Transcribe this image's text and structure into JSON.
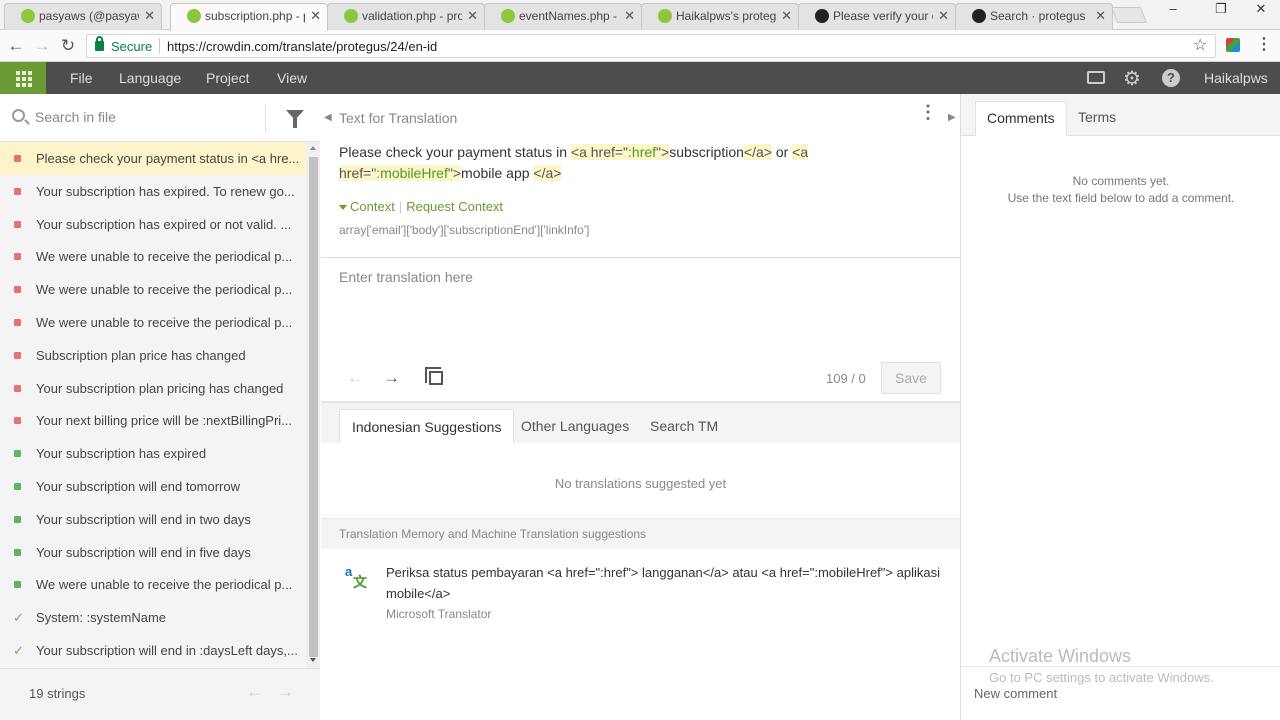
{
  "browser": {
    "tabs": [
      {
        "title": "pasyaws (@pasyaws",
        "icon": "chrome-icon"
      },
      {
        "title": "subscription.php - p",
        "icon": "crowdin-icon"
      },
      {
        "title": "validation.php - pro",
        "icon": "crowdin-icon"
      },
      {
        "title": "eventNames.php - p",
        "icon": "crowdin-icon"
      },
      {
        "title": "Haikalpws's protegu",
        "icon": "crowdin-icon"
      },
      {
        "title": "Please verify your e",
        "icon": "github-icon"
      },
      {
        "title": "Search · protegus",
        "icon": "github-icon"
      }
    ],
    "close_glyph": "✕",
    "window_controls": {
      "minimize": "–",
      "maximize": "❐",
      "close": "✕"
    },
    "secure_label": "Secure",
    "url": "https://crowdin.com/translate/protegus/24/en-id"
  },
  "topbar": {
    "menu": [
      "File",
      "Language",
      "Project",
      "View"
    ],
    "username": "Haikalpws"
  },
  "left": {
    "search_placeholder": "Search in file",
    "strings": [
      {
        "text": "Please check your payment status in <a hre...",
        "status": "untranslated",
        "selected": true
      },
      {
        "text": "Your subscription has expired. To renew go...",
        "status": "untranslated"
      },
      {
        "text": "Your subscription has expired or not valid. ...",
        "status": "untranslated"
      },
      {
        "text": "We were unable to receive the periodical p...",
        "status": "untranslated"
      },
      {
        "text": "We were unable to receive the periodical p...",
        "status": "untranslated"
      },
      {
        "text": "We were unable to receive the periodical p...",
        "status": "untranslated"
      },
      {
        "text": "Subscription plan price has changed",
        "status": "untranslated"
      },
      {
        "text": "Your subscription plan pricing has changed",
        "status": "untranslated"
      },
      {
        "text": "Your next billing price will be :nextBillingPri...",
        "status": "untranslated"
      },
      {
        "text": "Your subscription has expired",
        "status": "translated"
      },
      {
        "text": "Your subscription will end tomorrow",
        "status": "translated"
      },
      {
        "text": "Your subscription will end in two days",
        "status": "translated"
      },
      {
        "text": "Your subscription will end in five days",
        "status": "translated"
      },
      {
        "text": "We were unable to receive the periodical p...",
        "status": "translated"
      },
      {
        "text": "System: :systemName",
        "status": "approved"
      },
      {
        "text": "Your subscription will end in :daysLeft days,...",
        "status": "approved"
      }
    ],
    "strings_count": "19 strings"
  },
  "center": {
    "source_heading": "Text for Translation",
    "source_parts": [
      {
        "t": "Please check your payment status in "
      },
      {
        "tag": true,
        "pre": "<a href=\"",
        "attr": ":href",
        "post": "\">"
      },
      {
        "t": "subscription"
      },
      {
        "tag": true,
        "pre": "</a>",
        "attr": "",
        "post": ""
      },
      {
        "t": " or "
      },
      {
        "tag": true,
        "pre": "<a href=\"",
        "attr": ":mobileHref",
        "post": "\">"
      },
      {
        "t": "mobile app "
      },
      {
        "tag": true,
        "pre": "</a>",
        "attr": "",
        "post": ""
      }
    ],
    "context_label": "Context",
    "request_context_label": "Request Context",
    "context_key": "array['email']['body']['subscriptionEnd']['linkInfo']",
    "translation_placeholder": "Enter translation here",
    "char_count": "109 / 0",
    "save_label": "Save",
    "suggestion_tabs": [
      "Indonesian Suggestions",
      "Other Languages",
      "Search TM"
    ],
    "no_suggestions": "No translations suggested yet",
    "tm_heading": "Translation Memory and Machine Translation suggestions",
    "mt_suggestion": "Periksa status pembayaran <a href=\":href\"> langganan</a> atau <a href=\":mobileHref\"> aplikasi mobile</a>",
    "mt_source": "Microsoft Translator"
  },
  "right": {
    "tabs": [
      "Comments",
      "Terms"
    ],
    "no_comments_line1": "No comments yet.",
    "no_comments_line2": "Use the text field below to add a comment.",
    "watermark_title": "Activate Windows",
    "watermark_sub": "Go to PC settings to activate Windows.",
    "new_comment_placeholder": "New comment"
  },
  "colors": {
    "accent": "#6a9b34",
    "topbar": "#4d4d4d",
    "untranslated": "#e9726b",
    "translated": "#5cb85c",
    "selected_row": "#fdf4cc"
  }
}
